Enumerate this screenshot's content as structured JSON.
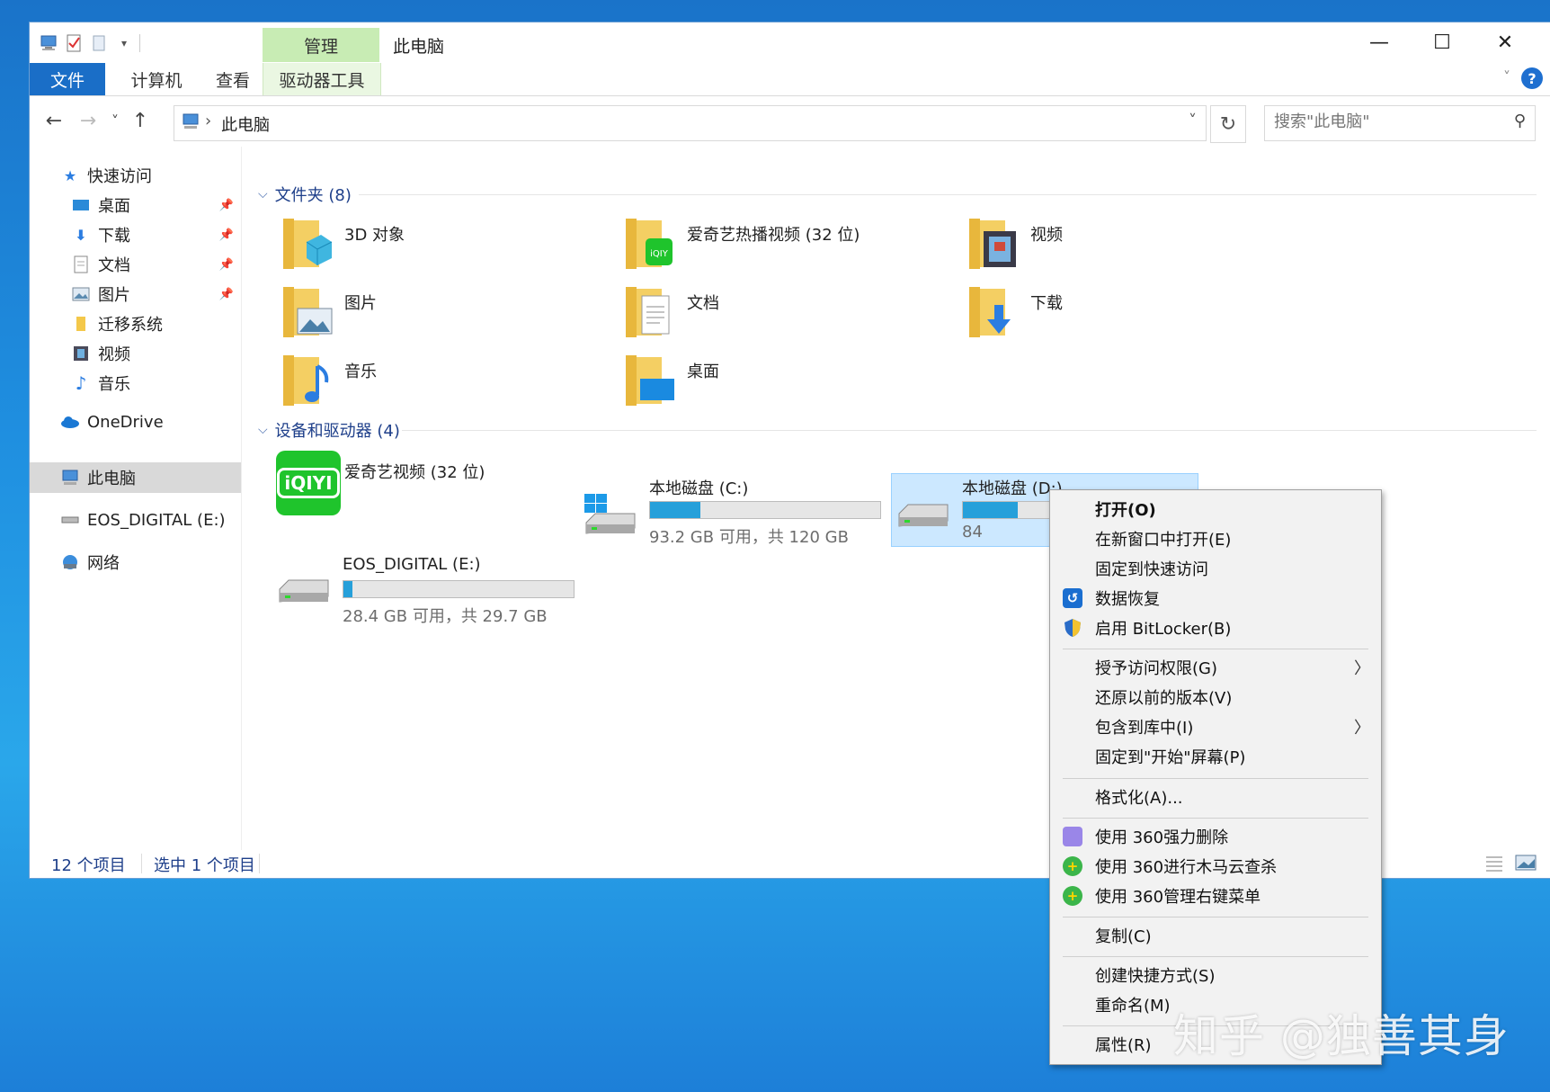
{
  "window": {
    "title": "此电脑",
    "context_tab_top": "管理",
    "minimize": "—",
    "maximize": "☐",
    "close": "✕"
  },
  "ribbon": {
    "tabs": [
      "文件",
      "计算机",
      "查看",
      "驱动器工具"
    ],
    "help": "?"
  },
  "nav": {
    "back": "←",
    "forward": "→",
    "recent": "˅",
    "up": "↑",
    "address_separator": "›",
    "address": "此电脑",
    "dropdown": "˅",
    "refresh": "↻",
    "search_placeholder": "搜索\"此电脑\"",
    "search_icon": "⚲"
  },
  "sidebar": {
    "quick_access": "快速访问",
    "pinned": [
      {
        "label": "桌面",
        "icon": "desktop-icon"
      },
      {
        "label": "下载",
        "icon": "download-icon"
      },
      {
        "label": "文档",
        "icon": "documents-icon"
      },
      {
        "label": "图片",
        "icon": "pictures-icon"
      }
    ],
    "unpinned": [
      {
        "label": "迁移系统",
        "icon": "folder-icon"
      },
      {
        "label": "视频",
        "icon": "video-icon"
      },
      {
        "label": "音乐",
        "icon": "music-icon"
      }
    ],
    "onedrive": "OneDrive",
    "this_pc": "此电脑",
    "eos": "EOS_DIGITAL (E:)",
    "network": "网络"
  },
  "folders": {
    "header": "文件夹 (8)",
    "items": [
      "3D 对象",
      "爱奇艺热播视频 (32 位)",
      "视频",
      "图片",
      "文档",
      "下载",
      "音乐",
      "桌面"
    ]
  },
  "devices": {
    "header": "设备和驱动器 (4)",
    "iqiyi_app": "爱奇艺视频 (32 位)",
    "iqiyi_logo": "iQIYI",
    "drives": [
      {
        "label": "本地磁盘 (C:)",
        "free_text": "93.2 GB 可用，共 120 GB",
        "used_fraction": 0.22
      },
      {
        "label": "本地磁盘 (D:)",
        "free_text": "84",
        "used_fraction": 0.24
      },
      {
        "label": "EOS_DIGITAL (E:)",
        "free_text": "28.4 GB 可用，共 29.7 GB",
        "used_fraction": 0.04
      }
    ]
  },
  "status": {
    "items": "12 个项目",
    "selected": "选中 1 个项目"
  },
  "context_menu": {
    "items": [
      {
        "label": "打开(O)",
        "bold": true
      },
      {
        "label": "在新窗口中打开(E)"
      },
      {
        "label": "固定到快速访问"
      },
      {
        "label": "数据恢复",
        "icon": "data-recovery-icon"
      },
      {
        "label": "启用 BitLocker(B)",
        "icon": "shield-icon"
      },
      {
        "label": "授予访问权限(G)",
        "submenu": true
      },
      {
        "label": "还原以前的版本(V)"
      },
      {
        "label": "包含到库中(I)",
        "submenu": true
      },
      {
        "label": "固定到\"开始\"屏幕(P)"
      },
      {
        "label": "格式化(A)..."
      },
      {
        "label": "使用 360强力删除",
        "icon": "360-delete-icon"
      },
      {
        "label": "使用 360进行木马云查杀",
        "icon": "360-scan-icon"
      },
      {
        "label": "使用 360管理右键菜单",
        "icon": "360-manage-icon"
      },
      {
        "label": "复制(C)"
      },
      {
        "label": "创建快捷方式(S)"
      },
      {
        "label": "重命名(M)"
      },
      {
        "label": "属性(R)"
      }
    ],
    "submenu_arrow": "〉"
  },
  "watermark": "知乎 @独善其身",
  "colors": {
    "accent": "#1a6ec7",
    "context_tab": "#c8ecb4",
    "drive_bar": "#26a0da",
    "selection": "#cce8ff",
    "iqiyi_green": "#1fc42c"
  }
}
